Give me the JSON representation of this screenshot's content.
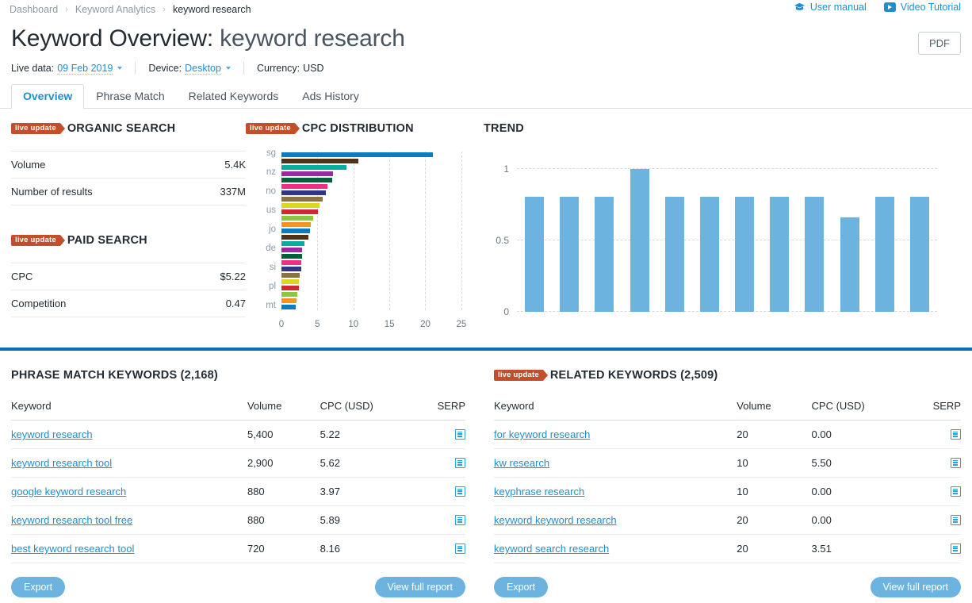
{
  "breadcrumb": {
    "items": [
      "Dashboard",
      "Keyword Analytics",
      "keyword research"
    ],
    "separator": "›"
  },
  "header": {
    "user_manual": "User manual",
    "video_tutorial": "Video Tutorial",
    "title_prefix": "Keyword Overview:",
    "title_keyword": "keyword research",
    "pdf_button": "PDF"
  },
  "meta": {
    "live_data_label": "Live data:",
    "live_data_value": "09 Feb 2019",
    "device_label": "Device:",
    "device_value": "Desktop",
    "currency_label": "Currency:",
    "currency_value": "USD"
  },
  "tabs": [
    {
      "label": "Overview",
      "active": true
    },
    {
      "label": "Phrase Match",
      "active": false
    },
    {
      "label": "Related Keywords",
      "active": false
    },
    {
      "label": "Ads History",
      "active": false
    }
  ],
  "live_update_badge": "live update",
  "organic": {
    "title": "ORGANIC SEARCH",
    "rows": [
      {
        "label": "Volume",
        "value": "5.4K"
      },
      {
        "label": "Number of results",
        "value": "337M"
      }
    ]
  },
  "paid": {
    "title": "PAID SEARCH",
    "rows": [
      {
        "label": "CPC",
        "value": "$5.22"
      },
      {
        "label": "Competition",
        "value": "0.47"
      }
    ]
  },
  "trend": {
    "title": "TREND"
  },
  "phrase_match": {
    "title": "PHRASE MATCH KEYWORDS (2,168)",
    "columns": [
      "Keyword",
      "Volume",
      "CPC (USD)",
      "SERP"
    ],
    "rows": [
      {
        "keyword": "keyword research",
        "volume": "5,400",
        "cpc": "5.22",
        "serp": "serp-icon"
      },
      {
        "keyword": "keyword research tool",
        "volume": "2,900",
        "cpc": "5.62",
        "serp": "serp-icon"
      },
      {
        "keyword": "google keyword research",
        "volume": "880",
        "cpc": "3.97",
        "serp": "serp-icon"
      },
      {
        "keyword": "keyword research tool free",
        "volume": "880",
        "cpc": "5.89",
        "serp": "serp-icon"
      },
      {
        "keyword": "best keyword research tool",
        "volume": "720",
        "cpc": "8.16",
        "serp": "serp-icon"
      }
    ],
    "export_label": "Export",
    "view_label": "View full report"
  },
  "related_keywords": {
    "title": "RELATED KEYWORDS (2,509)",
    "columns": [
      "Keyword",
      "Volume",
      "CPC (USD)",
      "SERP"
    ],
    "rows": [
      {
        "keyword": "for keyword research",
        "volume": "20",
        "cpc": "0.00",
        "serp": "serp-icon"
      },
      {
        "keyword": "kw research",
        "volume": "10",
        "cpc": "5.50",
        "serp": "serp-icon"
      },
      {
        "keyword": "keyphrase research",
        "volume": "10",
        "cpc": "0.00",
        "serp": "serp-icon"
      },
      {
        "keyword": "keyword keyword research",
        "volume": "20",
        "cpc": "0.00",
        "serp": "serp-icon"
      },
      {
        "keyword": "keyword search research",
        "volume": "20",
        "cpc": "3.51",
        "serp": "serp-icon"
      }
    ],
    "export_label": "Export",
    "view_label": "View full report"
  },
  "colors": {
    "accent_blue": "#1f8ecf",
    "divider_blue": "#0a6eb4",
    "badge_orange": "#c34e2b",
    "trend_bar": "#6cb3e0",
    "text": "#242c33",
    "muted": "#8d9aa5"
  },
  "chart_data": [
    {
      "type": "bar",
      "orientation": "horizontal",
      "title": "CPC DISTRIBUTION",
      "xlabel": "",
      "ylabel": "",
      "xlim": [
        0,
        27
      ],
      "xticks": [
        0,
        5,
        10,
        15,
        20,
        25
      ],
      "grid": true,
      "categories": [
        "sg",
        "",
        "",
        "nz",
        "",
        "",
        "no",
        "",
        "",
        "us",
        "",
        "",
        "jo",
        "",
        "",
        "de",
        "",
        "",
        "si",
        "",
        "",
        "pl",
        "",
        "",
        "mt"
      ],
      "values": [
        21.0,
        10.7,
        9.0,
        7.2,
        7.0,
        6.4,
        6.2,
        5.7,
        5.3,
        5.1,
        4.4,
        4.1,
        4.0,
        3.7,
        3.2,
        2.9,
        2.9,
        2.8,
        2.7,
        2.5,
        2.4,
        2.4,
        2.2,
        2.1,
        2.0
      ],
      "bar_colors": [
        "#0a7cc4",
        "#4e3318",
        "#09ad9e",
        "#9c2a9c",
        "#00613a",
        "#ec3087",
        "#32348b",
        "#8c7049",
        "#dcd821",
        "#cd2a33",
        "#8dc63f",
        "#f7941e",
        "#0a7cc4",
        "#4e3318",
        "#09ad9e",
        "#9c2a9c",
        "#00613a",
        "#ec3087",
        "#32348b",
        "#8c7049",
        "#dcd821",
        "#cd2a33",
        "#8dc63f",
        "#f7941e",
        "#0a7cc4"
      ]
    },
    {
      "type": "bar",
      "orientation": "vertical",
      "title": "TREND",
      "xlabel": "",
      "ylabel": "",
      "ylim": [
        0,
        1.08
      ],
      "yticks": [
        0,
        0.5,
        1
      ],
      "ytick_labels": [
        "0",
        "0.5",
        "1"
      ],
      "grid": true,
      "categories": [
        "1",
        "2",
        "3",
        "4",
        "5",
        "6",
        "7",
        "8",
        "9",
        "10",
        "11"
      ],
      "values": [
        0.81,
        0.81,
        0.81,
        1.0,
        0.81,
        0.81,
        0.81,
        0.81,
        0.81,
        0.66,
        0.81,
        0.81
      ],
      "bar_color": "#6cb3e0"
    }
  ]
}
